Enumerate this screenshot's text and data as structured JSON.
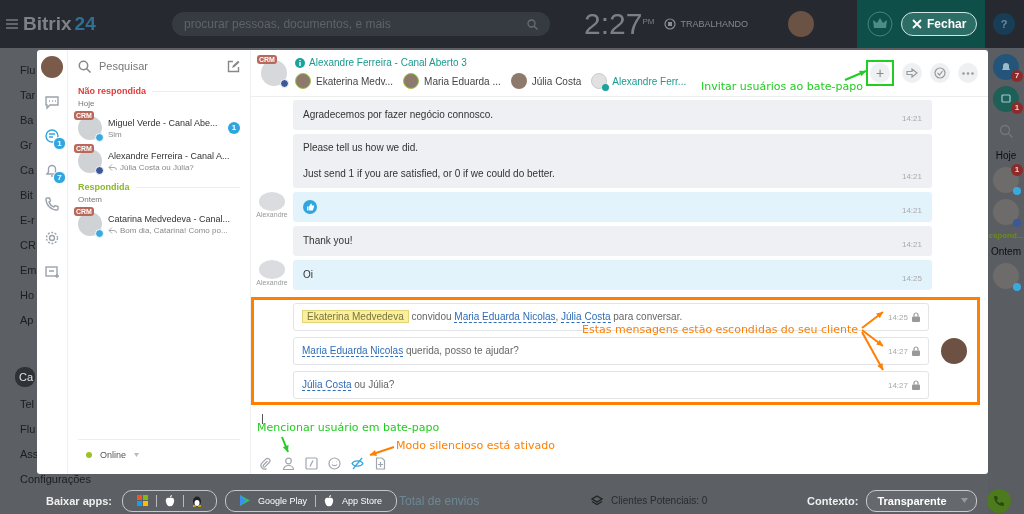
{
  "topbar": {
    "logo_name": "Bitrix",
    "logo_number": "24",
    "search": {
      "placeholder": "procurar pessoas, documentos, e mais"
    },
    "clock": "2:27",
    "clock_suffix": "PM",
    "work_status": "TRABALHANDO",
    "close_button": "Fechar",
    "help_button": "?"
  },
  "background_menu": [
    {
      "label": "Flu",
      "selected": false
    },
    {
      "label": "Tar",
      "selected": false
    },
    {
      "label": "Ba",
      "selected": false
    },
    {
      "label": "Gr",
      "selected": false
    },
    {
      "label": "Ca",
      "selected": false
    },
    {
      "label": "Bit",
      "selected": false
    },
    {
      "label": "E-r",
      "selected": false
    },
    {
      "label": "CR",
      "selected": false
    },
    {
      "label": "Em",
      "selected": false
    },
    {
      "label": "Ho",
      "selected": false
    },
    {
      "label": "Ap",
      "selected": false
    },
    {
      "label": "Ca",
      "selected": true
    },
    {
      "label": "Tel",
      "selected": false
    },
    {
      "label": "Flu",
      "selected": false
    },
    {
      "label": "Ass",
      "selected": false
    },
    {
      "label": "Configurações",
      "selected": false
    }
  ],
  "right_panel": {
    "notifications_badge": "7",
    "channels_badge": "1",
    "groups": [
      {
        "date": "Hoje",
        "items": [
          {
            "badge": "1",
            "color": "#3aa9e0"
          },
          {
            "color": "#3b5998"
          }
        ]
      },
      {
        "title": "espond...",
        "date": "Ontem",
        "items": [
          {
            "color": "#3aa9e0"
          }
        ]
      }
    ]
  },
  "bottom_bar": {
    "apps_label": "Baixar apps:",
    "stores": [
      "Google Play",
      "App Store"
    ],
    "background_card": "Total de envios",
    "leads": "Clientes Potenciais: 0",
    "context_label": "Contexto:",
    "context_value": "Transparente"
  },
  "messenger": {
    "rail": [
      {
        "kind": "chat",
        "selected": false
      },
      {
        "kind": "channels",
        "selected": true,
        "badge": "1"
      },
      {
        "kind": "notifications",
        "selected": false,
        "badge": "7"
      },
      {
        "kind": "phone",
        "selected": false
      },
      {
        "kind": "settings",
        "selected": false
      },
      {
        "kind": "new-chat",
        "selected": false
      }
    ],
    "recent": {
      "search": {
        "placeholder": "Pesquisar"
      },
      "groups": [
        {
          "kind": "unanswered",
          "title": "Não respondida",
          "date": "Hoje",
          "items": [
            {
              "crm": "CRM",
              "name": "Miguel Verde - Canal Abe...",
              "preview": "Sim",
              "reply": false,
              "counter": "1",
              "color": "#3aa9e0"
            },
            {
              "crm": "CRM",
              "name": "Alexandre Ferreira - Canal A...",
              "preview": "Júlia Costa ou Júlia?",
              "reply": true,
              "color": "#3b5998"
            }
          ]
        },
        {
          "kind": "answered",
          "title": "Respondida",
          "date": "Ontem",
          "items": [
            {
              "crm": "CRM",
              "name": "Catarina Medvedeva - Canal...",
              "preview": "Bom dia, Catarina! Como po...",
              "reply": true,
              "color": "#3aa9e0"
            }
          ]
        }
      ],
      "status": "Online"
    },
    "chat": {
      "crm": "CRM",
      "title": "Alexandre Ferreira - Canal Aberto 3",
      "participants": [
        {
          "name": "Ekaterina Medv...",
          "kind": "employee",
          "online": true
        },
        {
          "name": "Maria Eduarda ...",
          "kind": "employee",
          "online": true
        },
        {
          "name": "Júlia Costa",
          "kind": "employee",
          "online": false
        },
        {
          "name": "Alexandre Ferr...",
          "kind": "client",
          "online": false
        }
      ],
      "actions": [
        {
          "kind": "add",
          "label": "+"
        },
        {
          "kind": "transfer"
        },
        {
          "kind": "finish"
        },
        {
          "kind": "more"
        }
      ],
      "messages": [
        {
          "kind": "operator",
          "paragraphs": [
            "Agradecemos por fazer negócio connosco."
          ],
          "time": "14:21"
        },
        {
          "kind": "operator",
          "paragraphs": [
            "Please tell us how we did.",
            "Just send 1 if you are satisfied, or 0 if we could do better."
          ],
          "time": "14:21"
        },
        {
          "kind": "client",
          "author": "Alexandre",
          "like": true,
          "time": "14:21"
        },
        {
          "kind": "operator",
          "paragraphs": [
            "Thank you!"
          ],
          "time": "14:21"
        },
        {
          "kind": "client",
          "author": "Alexandre",
          "paragraphs": [
            "Oi"
          ],
          "time": "14:25"
        }
      ],
      "hidden_messages": [
        {
          "parts": [
            {
              "kind": "tag",
              "text": "Ekaterina Medvedeva"
            },
            {
              "kind": "plain",
              "text": "convidou"
            },
            {
              "kind": "mention",
              "text": "Maria Eduarda Nicolas"
            },
            {
              "kind": "punct",
              "text": ","
            },
            {
              "kind": "mention",
              "text": "Júlia Costa"
            },
            {
              "kind": "plain",
              "text": "para conversar."
            }
          ],
          "time": "14:25"
        },
        {
          "parts": [
            {
              "kind": "mention",
              "text": "Maria Eduarda Nicolas"
            },
            {
              "kind": "plain",
              "text": "querida, posso te ajudar?"
            }
          ],
          "time": "14:27"
        },
        {
          "parts": [
            {
              "kind": "mention",
              "text": "Júlia Costa"
            },
            {
              "kind": "plain",
              "text": "ou Júlia?"
            }
          ],
          "time": "14:27"
        }
      ],
      "toolbar": [
        {
          "kind": "attach",
          "active": false
        },
        {
          "kind": "mention",
          "active": false
        },
        {
          "kind": "command",
          "active": false
        },
        {
          "kind": "smile",
          "active": false
        },
        {
          "kind": "silent",
          "active": true
        },
        {
          "kind": "file",
          "active": false
        }
      ]
    }
  },
  "annotations": [
    {
      "text": "Invitar usuários ao bate-papo",
      "color": "#22cc22"
    },
    {
      "text": "Estas mensagens estão escondidas do seu cliente",
      "color": "#ff7f00"
    },
    {
      "text": "Mencionar usuário em bate-papo",
      "color": "#22cc22"
    },
    {
      "text": "Modo silencioso está ativado",
      "color": "#ff7f00"
    }
  ]
}
